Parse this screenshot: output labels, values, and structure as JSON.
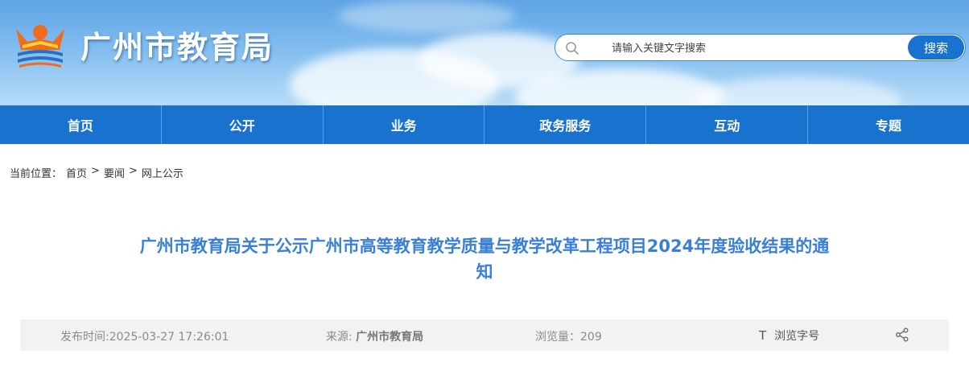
{
  "header": {
    "site_title": "广州市教育局",
    "search_placeholder": "请输入关键文字搜索",
    "search_button": "搜索",
    "colors": {
      "banner_top": "#5fa4e4",
      "accent": "#1a72cf",
      "logo_orange": "#f26a1b",
      "logo_blue": "#2a6fc0"
    }
  },
  "nav": {
    "items": [
      {
        "label": "首页"
      },
      {
        "label": "公开"
      },
      {
        "label": "业务"
      },
      {
        "label": "政务服务"
      },
      {
        "label": "互动"
      },
      {
        "label": "专题"
      }
    ]
  },
  "breadcrumb": {
    "prefix": "当前位置：",
    "items": [
      "首页",
      "要闻",
      "网上公示"
    ],
    "separator": ">"
  },
  "article": {
    "title_line1": "广州市教育局关于公示广州市高等教育教学质量与教学改革工程项目2024年度验收结果的通",
    "title_line2": "知",
    "title_color": "#3a7fd6"
  },
  "meta": {
    "publish_time": "发布时间:2025-03-27 17:26:01",
    "source_label": "来源: ",
    "source_value": "广州市教育局",
    "views": "浏览量：209",
    "font_icon": "T",
    "font_label": "浏览字号",
    "share_icon": "share-icon"
  }
}
